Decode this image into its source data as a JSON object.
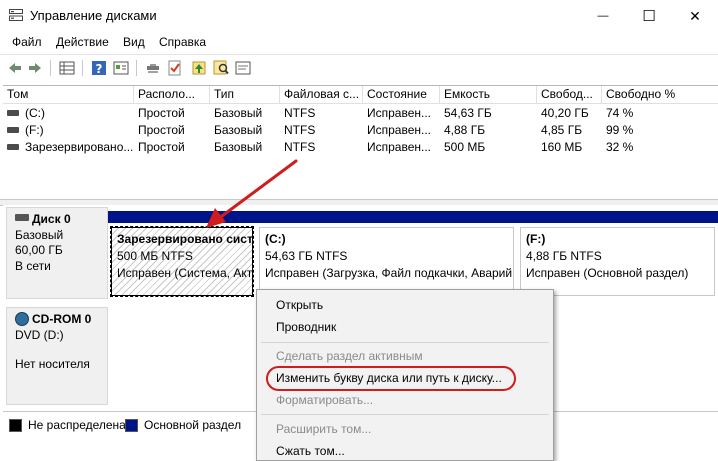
{
  "window": {
    "title": "Управление дисками",
    "minimize_glyph": "—",
    "maximize_glyph": "☐",
    "close_glyph": "✕"
  },
  "menu": [
    "Файл",
    "Действие",
    "Вид",
    "Справка"
  ],
  "toolbar": {
    "icons": [
      "back-icon",
      "forward-icon",
      "disk-list-icon",
      "help-icon",
      "properties-icon",
      "connect-icon",
      "check-icon",
      "up-icon",
      "search-icon",
      "console-icon"
    ]
  },
  "volume_list": {
    "headers": [
      "Том",
      "Располо...",
      "Тип",
      "Файловая с...",
      "Состояние",
      "Емкость",
      "Свобод...",
      "Свободно %"
    ],
    "rows": [
      [
        "(C:)",
        "Простой",
        "Базовый",
        "NTFS",
        "Исправен...",
        "54,63 ГБ",
        "40,20 ГБ",
        "74 %"
      ],
      [
        "(F:)",
        "Простой",
        "Базовый",
        "NTFS",
        "Исправен...",
        "4,88 ГБ",
        "4,85 ГБ",
        "99 %"
      ],
      [
        "Зарезервировано...",
        "Простой",
        "Базовый",
        "NTFS",
        "Исправен...",
        "500 МБ",
        "160 МБ",
        "32 %"
      ]
    ]
  },
  "disks": {
    "disk0": {
      "name": "Диск 0",
      "type": "Базовый",
      "size": "60,00 ГБ",
      "status": "В сети"
    },
    "cdrom0": {
      "name": "CD-ROM 0",
      "drive": "DVD (D:)",
      "status": "Нет носителя"
    },
    "partitions": [
      {
        "name": "Зарезервировано сист",
        "size": "500 МБ NTFS",
        "status": "Исправен (Система, Акт"
      },
      {
        "name": "(C:)",
        "size": "54,63 ГБ NTFS",
        "status": "Исправен (Загрузка, Файл подкачки, Аварий"
      },
      {
        "name": "(F:)",
        "size": "4,88 ГБ NTFS",
        "status": "Исправен (Основной раздел)"
      }
    ]
  },
  "legend": {
    "unallocated": "Не распределена",
    "primary": "Основной раздел",
    "unallocated_color": "#000000",
    "primary_color": "#00148a"
  },
  "context_menu": {
    "open": "Открыть",
    "explorer": "Проводник",
    "mark_active": "Сделать раздел активным",
    "change_letter": "Изменить букву диска или путь к диску...",
    "format": "Форматировать...",
    "extend": "Расширить том...",
    "shrink": "Сжать том..."
  },
  "colors": {
    "partition_bar": "#00148a",
    "annotation_red": "#d01c1c"
  }
}
